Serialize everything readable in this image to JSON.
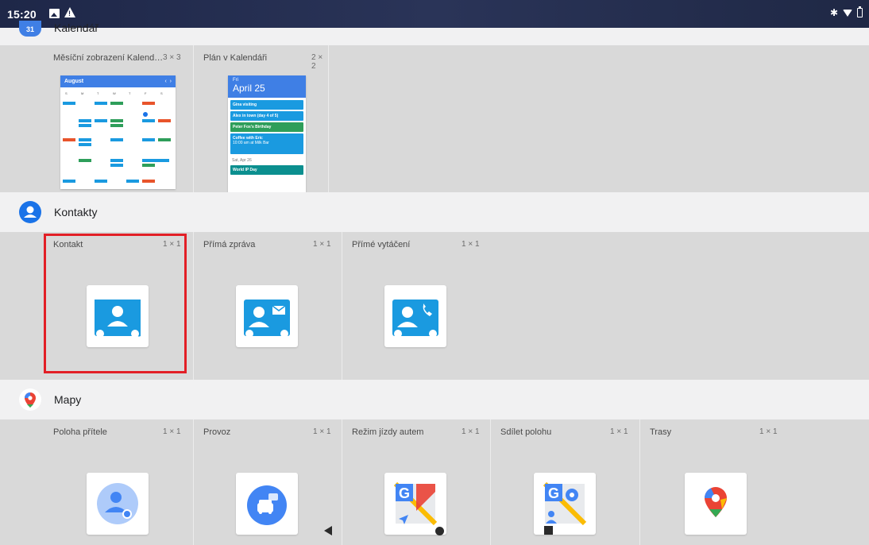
{
  "status_bar": {
    "time": "15:20"
  },
  "calendar_section": {
    "app_label": "Kalendář",
    "widgets": [
      {
        "name": "Měsíční zobrazení Kalend…",
        "size": "3 × 3"
      },
      {
        "name": "Plán v Kalendáři",
        "size": "2 × 2"
      }
    ],
    "month_preview": {
      "month": "August",
      "weekdays": [
        "S",
        "M",
        "T",
        "W",
        "T",
        "F",
        "S"
      ]
    },
    "agenda_preview": {
      "day": "Fri",
      "date": "April 25",
      "events": [
        "Gina visiting",
        "Alex in town (day 4 of 5)",
        "Peter Fox's Birthday",
        "Coffee with Eric",
        "10:00 am at Milk Bar"
      ],
      "next_day": "Sat, Apr 26",
      "next_event": "World IP Day"
    }
  },
  "contacts_section": {
    "app_label": "Kontakty",
    "widgets": [
      {
        "name": "Kontakt",
        "size": "1 × 1"
      },
      {
        "name": "Přímá zpráva",
        "size": "1 × 1"
      },
      {
        "name": "Přímé vytáčení",
        "size": "1 × 1"
      }
    ]
  },
  "maps_section": {
    "app_label": "Mapy",
    "widgets": [
      {
        "name": "Poloha přítele",
        "size": "1 × 1"
      },
      {
        "name": "Provoz",
        "size": "1 × 1"
      },
      {
        "name": "Režim jízdy autem",
        "size": "1 × 1"
      },
      {
        "name": "Sdílet polohu",
        "size": "1 × 1"
      },
      {
        "name": "Trasy",
        "size": "1 × 1"
      }
    ]
  },
  "colors": {
    "contacts_blue": "#1a9ae0",
    "highlight_red": "#e21f26",
    "calendar_blue": "#3f7fe5"
  }
}
